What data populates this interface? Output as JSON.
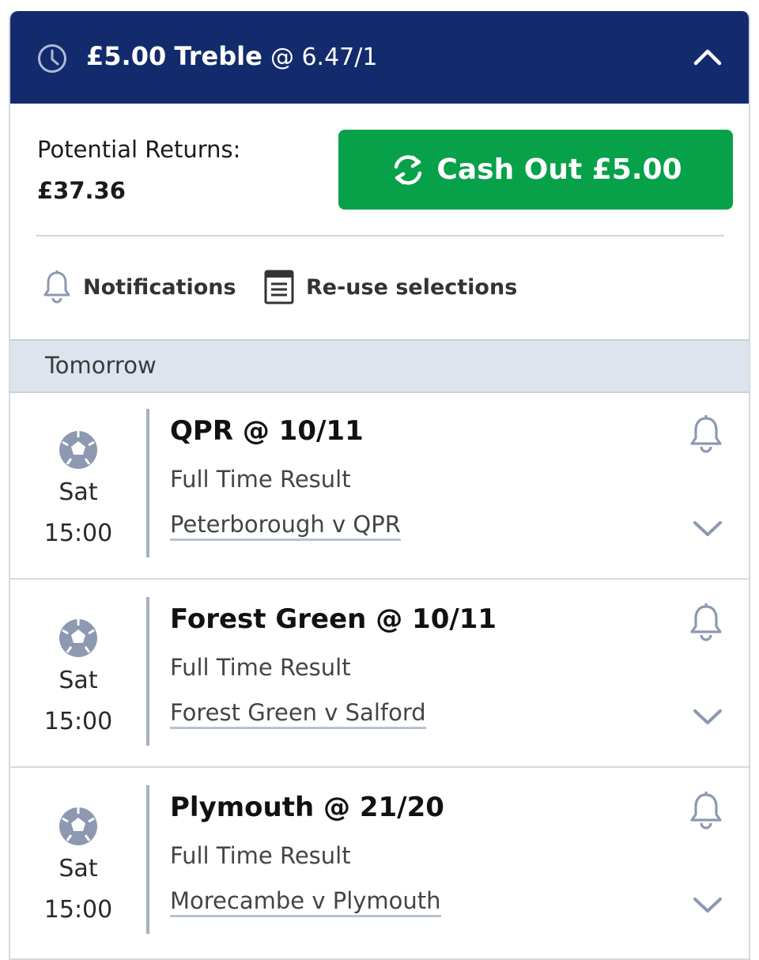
{
  "header": {
    "stake": "£5.00",
    "bet_type": "Treble",
    "odds": "@ 6.47/1"
  },
  "summary": {
    "returns_label": "Potential Returns:",
    "returns_value": "£37.36",
    "cashout_label": "Cash Out £5.00"
  },
  "actions": {
    "notifications_label": "Notifications",
    "reuse_label": "Re-use selections"
  },
  "day_header": "Tomorrow",
  "selections": [
    {
      "name": "QPR @ 10/11",
      "market": "Full Time Result",
      "event": "Peterborough v QPR",
      "day": "Sat",
      "time": "15:00"
    },
    {
      "name": "Forest Green @ 10/11",
      "market": "Full Time Result",
      "event": "Forest Green v Salford",
      "day": "Sat",
      "time": "15:00"
    },
    {
      "name": "Plymouth @ 21/20",
      "market": "Full Time Result",
      "event": "Morecambe v Plymouth",
      "day": "Sat",
      "time": "15:00"
    }
  ],
  "colors": {
    "header_bg": "#132b6c",
    "cashout_bg": "#07a14a",
    "icon_grey": "#8c99b0"
  }
}
